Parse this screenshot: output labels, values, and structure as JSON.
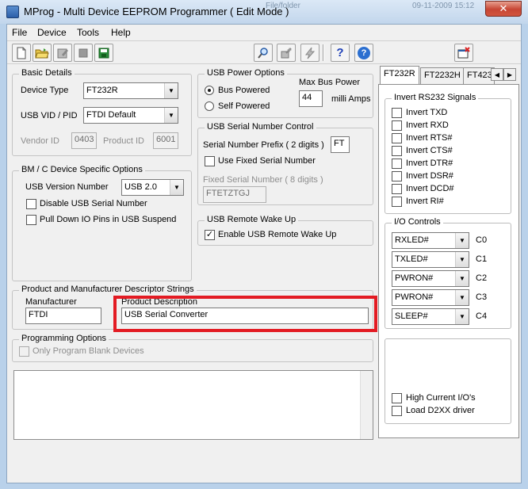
{
  "window": {
    "title": "MProg - Multi Device EEPROM Programmer ( Edit Mode )",
    "ghost_text_1": "File/folder",
    "ghost_text_2": "09-11-2009 15:12",
    "close_glyph": "✕"
  },
  "menu": {
    "file": "File",
    "device": "Device",
    "tools": "Tools",
    "help": "Help"
  },
  "toolbar": {
    "icons": [
      "new-file-icon",
      "open-folder-icon",
      "edit-icon",
      "stop-icon",
      "save-icon",
      "search-icon",
      "settings-wand-icon",
      "program-lightning-icon",
      "help-question-icon",
      "info-icon",
      "exit-dialog-icon"
    ],
    "help_glyph": "?",
    "info_glyph": "?",
    "save_glyph": "▣"
  },
  "basic_details": {
    "title": "Basic Details",
    "device_type_label": "Device Type",
    "device_type_value": "FT232R",
    "vid_pid_label": "USB VID / PID",
    "vid_pid_value": "FTDI Default",
    "vendor_id_label": "Vendor ID",
    "vendor_id_value": "0403",
    "product_id_label": "Product ID",
    "product_id_value": "6001"
  },
  "usb_power": {
    "title": "USB Power Options",
    "bus_powered": "Bus Powered",
    "self_powered": "Self Powered",
    "max_bus_power_label": "Max Bus Power",
    "max_bus_power_value": "44",
    "milli_amps": "milli Amps",
    "selected": "bus"
  },
  "serial_number": {
    "title": "USB Serial Number Control",
    "prefix_label": "Serial Number Prefix ( 2 digits )",
    "prefix_value": "FT",
    "use_fixed_label": "Use Fixed Serial Number",
    "use_fixed_checked": false,
    "fixed_label": "Fixed Serial Number ( 8 digits )",
    "fixed_value": "FTETZTGJ"
  },
  "bm_c_options": {
    "title": "BM / C Device Specific Options",
    "usb_version_label": "USB Version Number",
    "usb_version_value": "USB 2.0",
    "disable_serial_label": "Disable USB Serial Number",
    "pull_down_label": "Pull Down IO Pins in USB Suspend"
  },
  "remote_wake": {
    "title": "USB Remote Wake Up",
    "enable_label": "Enable USB Remote Wake Up",
    "enable_checked": true
  },
  "descriptors": {
    "title": "Product and Manufacturer Descriptor Strings",
    "manufacturer_label": "Manufacturer",
    "manufacturer_value": "FTDI",
    "product_label": "Product Description",
    "product_value": "USB Serial Converter"
  },
  "programming": {
    "title": "Programming Options",
    "blank_only_label": "Only Program Blank Devices"
  },
  "tabs": {
    "items": [
      "FT232R",
      "FT2232H",
      "FT423"
    ],
    "active": "FT232R",
    "left_glyph": "◀",
    "right_glyph": "▶"
  },
  "invert_rs232": {
    "title": "Invert RS232 Signals",
    "signals": [
      "Invert TXD",
      "Invert RXD",
      "Invert RTS#",
      "Invert CTS#",
      "Invert DTR#",
      "Invert DSR#",
      "Invert DCD#",
      "Invert RI#"
    ]
  },
  "io_controls": {
    "title": "I/O Controls",
    "rows": [
      {
        "value": "RXLED#",
        "pin": "C0"
      },
      {
        "value": "TXLED#",
        "pin": "C1"
      },
      {
        "value": "PWRON#",
        "pin": "C2"
      },
      {
        "value": "PWRON#",
        "pin": "C3"
      },
      {
        "value": "SLEEP#",
        "pin": "C4"
      }
    ]
  },
  "extra_options": {
    "high_current": "High Current I/O's",
    "load_d2xx": "Load D2XX driver"
  },
  "colors": {
    "highlight": "#e31b23",
    "window_frame": "#b9d1ea"
  }
}
